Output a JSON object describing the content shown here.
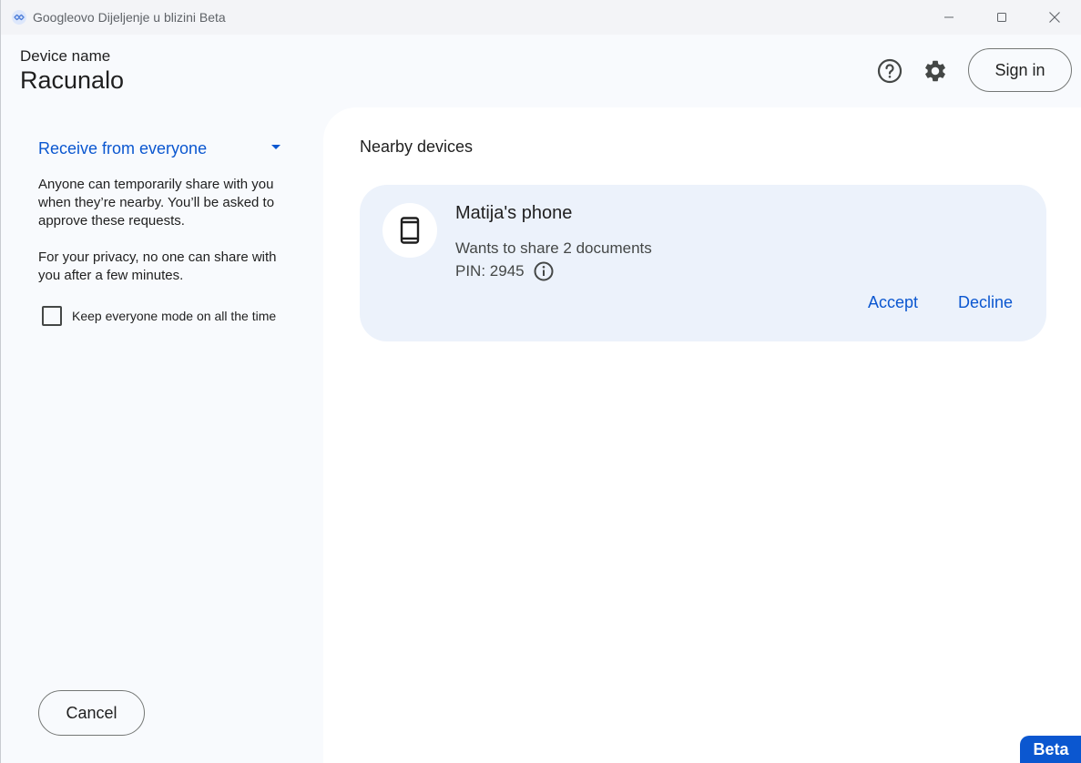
{
  "window": {
    "title": "Googleovo Dijeljenje u blizini Beta",
    "icons": {
      "app": "nearby-share-icon",
      "minimize": "minimize-icon",
      "maximize": "maximize-icon",
      "close": "close-icon"
    }
  },
  "header": {
    "device_label": "Device name",
    "device_name": "Racunalo",
    "help_icon": "help-icon",
    "settings_icon": "gear-icon",
    "sign_in_label": "Sign in"
  },
  "sidebar": {
    "mode_label": "Receive from everyone",
    "description_1": "Anyone can temporarily share with you when they’re nearby. You’ll be asked to approve these requests.",
    "description_2": "For your privacy, no one can share with you after a few minutes.",
    "keep_mode_label": "Keep everyone mode on all the time",
    "keep_mode_checked": false,
    "cancel_label": "Cancel"
  },
  "main": {
    "section_title": "Nearby devices",
    "request": {
      "sender_name": "Matija's phone",
      "description": "Wants to share 2 documents",
      "pin": "PIN: 2945",
      "device_icon": "phone-icon",
      "info_icon": "info-icon",
      "accept_label": "Accept",
      "decline_label": "Decline"
    }
  },
  "badge": {
    "label": "Beta"
  },
  "colors": {
    "accent": "#0b57d0",
    "card_background": "#ecf2fb",
    "sidebar_background": "#f8fafd",
    "panel_background": "#ffffff"
  }
}
